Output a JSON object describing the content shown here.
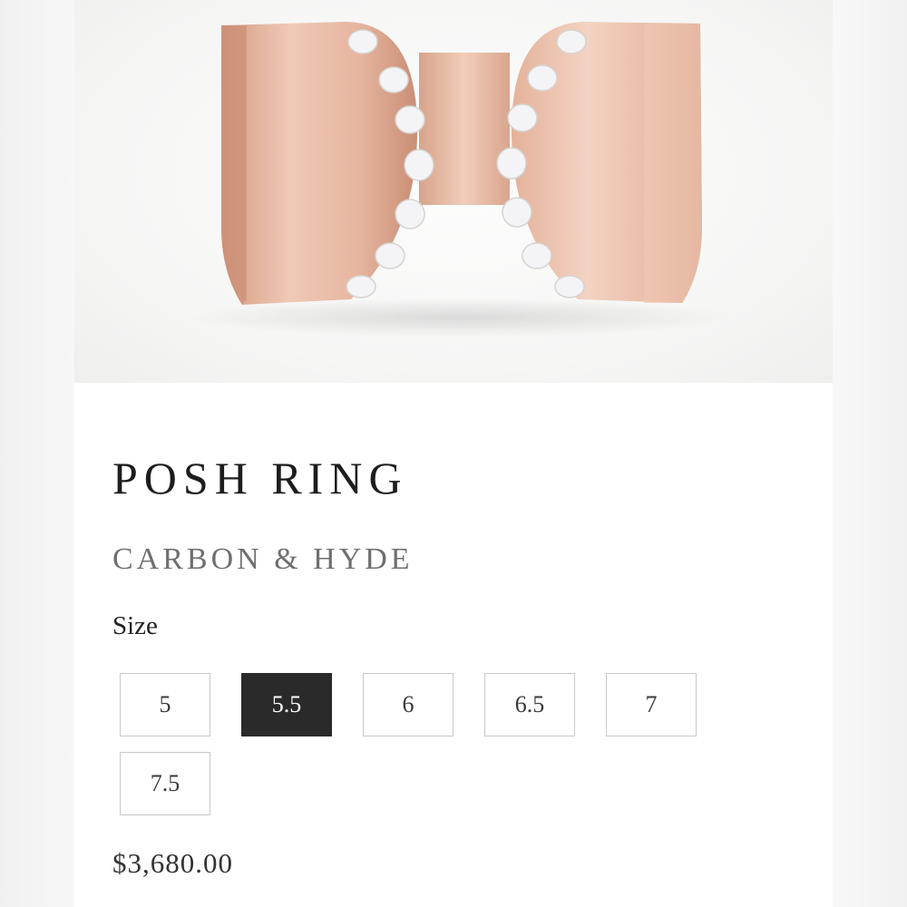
{
  "product": {
    "title": "POSH RING",
    "brand": "CARBON & HYDE",
    "image_alt": "rose-gold-ring-image"
  },
  "size_selector": {
    "label": "Size",
    "options": [
      "5",
      "5.5",
      "6",
      "6.5",
      "7",
      "7.5"
    ],
    "selected": "5.5"
  },
  "price": "$3,680.00",
  "colors": {
    "rose_gold": "#e3b49c",
    "selected_bg": "#2a2a2a"
  }
}
